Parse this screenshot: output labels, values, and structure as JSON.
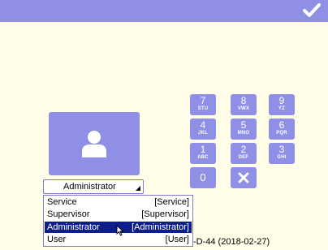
{
  "header": {
    "accent_color": "#8F8FE6",
    "confirm_icon": "checkmark-icon"
  },
  "login": {
    "avatar_icon": "user-icon",
    "role_select": {
      "value": "Administrator",
      "arrow_icon": "dropdown-arrow-icon"
    },
    "role_options": [
      {
        "label": "Service",
        "tag": "[Service]",
        "selected": false
      },
      {
        "label": "Supervisor",
        "tag": "[Supervisor]",
        "selected": false
      },
      {
        "label": "Administrator",
        "tag": "[Administrator]",
        "selected": true
      },
      {
        "label": "User",
        "tag": "[User]",
        "selected": false
      }
    ]
  },
  "keypad": {
    "keys": [
      {
        "digit": "7",
        "letters": "STU"
      },
      {
        "digit": "8",
        "letters": "VWX"
      },
      {
        "digit": "9",
        "letters": "YZ"
      },
      {
        "digit": "4",
        "letters": "JKL"
      },
      {
        "digit": "5",
        "letters": "MNO"
      },
      {
        "digit": "6",
        "letters": "PQR"
      },
      {
        "digit": "1",
        "letters": "ABC"
      },
      {
        "digit": "2",
        "letters": "DEF"
      },
      {
        "digit": "3",
        "letters": "GHI"
      },
      {
        "digit": "0",
        "letters": ""
      }
    ],
    "clear_icon": "close-icon"
  },
  "footer": {
    "version_text": "-D-44   (2018-02-27)"
  }
}
